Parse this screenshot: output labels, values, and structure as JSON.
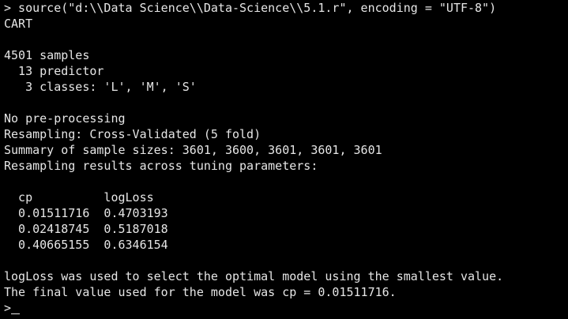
{
  "console": {
    "lines": [
      "> source(\"d:\\\\Data Science\\\\Data-Science\\\\5.1.r\", encoding = \"UTF-8\")",
      "CART",
      "",
      "4501 samples",
      "  13 predictor",
      "   3 classes: 'L', 'M', 'S'",
      "",
      "No pre-processing",
      "Resampling: Cross-Validated (5 fold)",
      "Summary of sample sizes: 3601, 3600, 3601, 3601, 3601",
      "Resampling results across tuning parameters:",
      "",
      "  cp          logLoss",
      "  0.01511716  0.4703193",
      "  0.02418745  0.5187018",
      "  0.40665155  0.6346154",
      "",
      "logLoss was used to select the optimal model using the smallest value.",
      "The final value used for the model was cp = 0.01511716.",
      ">"
    ]
  },
  "colors": {
    "background": "#000000",
    "text": "#E6E6E6"
  }
}
